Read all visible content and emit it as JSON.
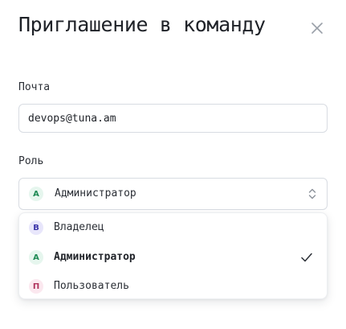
{
  "dialog": {
    "title": "Приглашение в команду",
    "close_icon": "close-icon"
  },
  "email": {
    "label": "Почта",
    "value": "devops@tuna.am"
  },
  "role": {
    "label": "Роль",
    "selected": {
      "badge": "А",
      "label": "Администратор"
    },
    "options": [
      {
        "badge": "В",
        "label": "Владелец",
        "badge_color": "#3b35a8",
        "selected": false
      },
      {
        "badge": "А",
        "label": "Администратор",
        "badge_color": "#1f8a55",
        "selected": true
      },
      {
        "badge": "П",
        "label": "Пользователь",
        "badge_color": "#b0335d",
        "selected": false
      }
    ],
    "icons": {
      "toggle": "chevron-up-down-icon",
      "selected_marker": "check-icon"
    }
  }
}
